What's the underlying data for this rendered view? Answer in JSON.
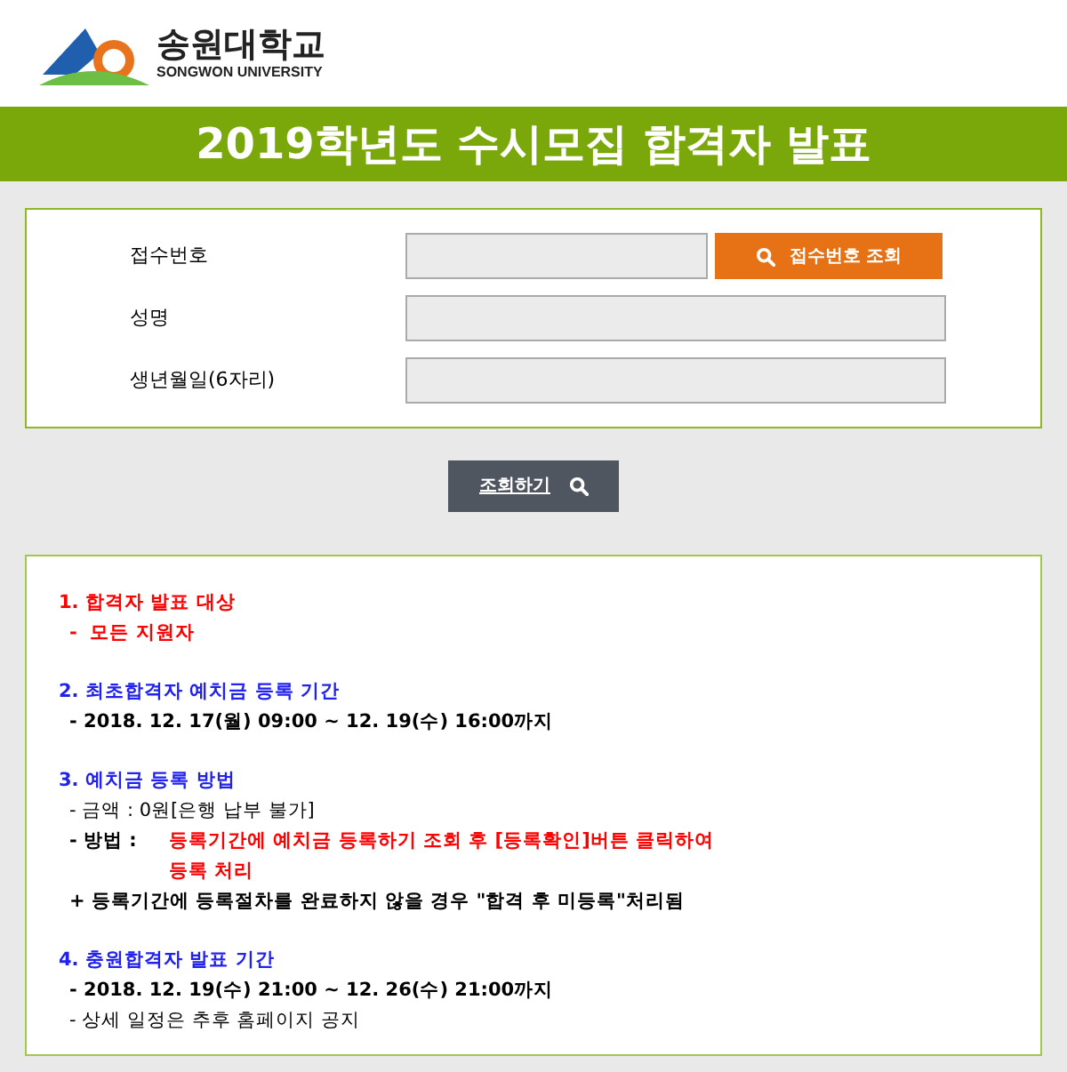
{
  "header": {
    "logo_name": "송원대학교",
    "logo_subtitle": "SONGWON UNIVERSITY"
  },
  "banner": {
    "title": "2019학년도 수시모집 합격자 발표"
  },
  "form": {
    "fields": [
      {
        "label": "접수번호",
        "kind": "with_button",
        "button": "접수번호 조회"
      },
      {
        "label": "성명",
        "kind": "plain"
      },
      {
        "label": "생년월일(6자리)",
        "kind": "plain"
      }
    ]
  },
  "submit_button": "조회하기",
  "notice": {
    "sections": [
      {
        "title": "1. 합격자 발표 대상",
        "color": "#ff0000",
        "lines": [
          {
            "kind": "alert",
            "text": "-  모든 지원자"
          }
        ]
      },
      {
        "title": "2. 최초합격자 예치금 등록 기간",
        "color": "#2222ee",
        "lines": [
          {
            "kind": "bold",
            "text": "- 2018. 12. 17(월) 09:00 ~ 12. 19(수) 16:00까지"
          }
        ]
      },
      {
        "title": "3. 예치금 등록 방법",
        "color": "#2222ee",
        "lines": [
          {
            "kind": "plain",
            "text": "- 금액 : 0원[은행 납부 불가]"
          },
          {
            "kind": "label_value",
            "label": "- 방법 :",
            "text": "등록기간에 예치금 등록하기 조회 후 [등록확인]버튼 클릭하여"
          },
          {
            "kind": "continuation",
            "text": "등록 처리"
          },
          {
            "kind": "bold",
            "text": "+ 등록기간에 등록절차를 완료하지 않을 경우 \"합격 후 미등록\"처리됨"
          }
        ]
      },
      {
        "title": "4. 충원합격자 발표 기간",
        "color": "#2222ee",
        "lines": [
          {
            "kind": "bold",
            "text": "- 2018. 12. 19(수) 21:00 ~ 12. 26(수) 21:00까지"
          },
          {
            "kind": "plain",
            "text": "- 상세 일정은 추후 홈페이지 공지"
          }
        ]
      }
    ]
  }
}
